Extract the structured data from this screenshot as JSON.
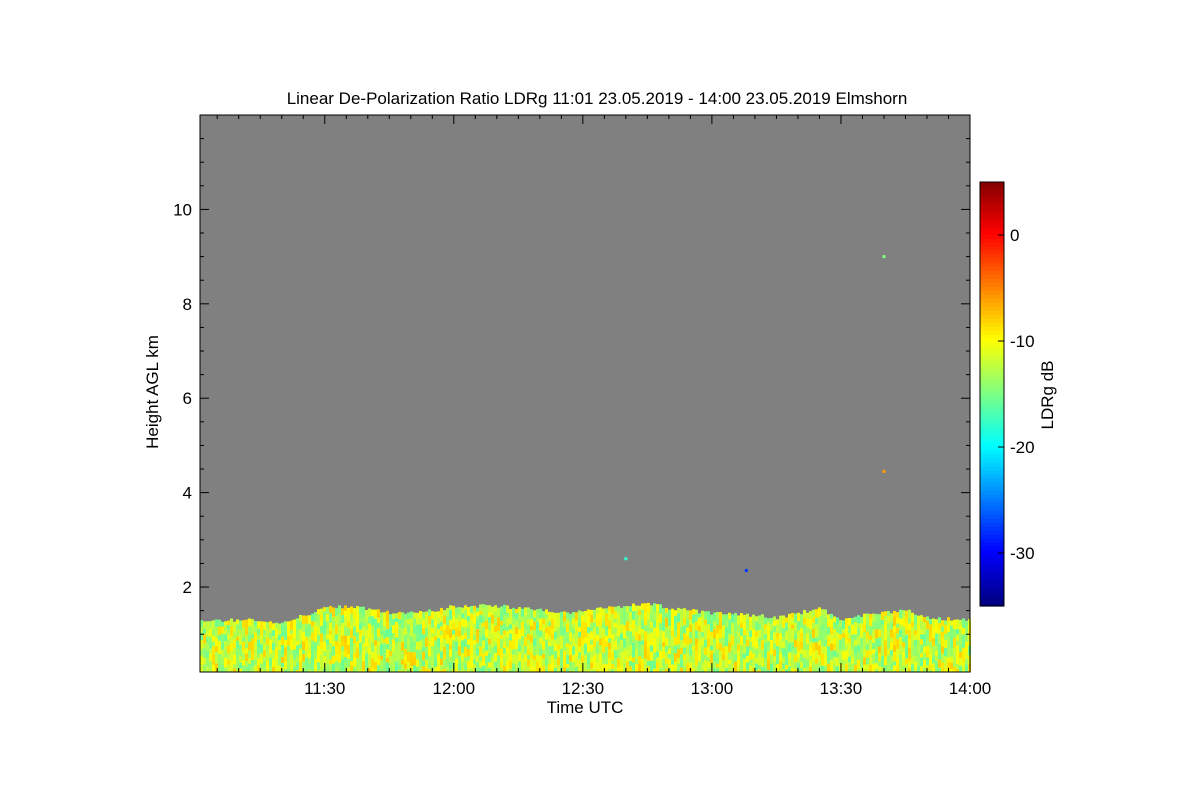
{
  "chart_data": {
    "type": "heatmap",
    "title": "Linear De-Polarization Ratio LDRg   11:01 23.05.2019 - 14:00 23.05.2019 Elmshorn",
    "xlabel": "Time UTC",
    "ylabel": "Height AGL km",
    "x_range": [
      "11:01",
      "14:00"
    ],
    "x_ticks": [
      "11:30",
      "12:00",
      "12:30",
      "13:00",
      "13:30",
      "14:00"
    ],
    "ylim": [
      0.2,
      12.0
    ],
    "y_ticks": [
      2,
      4,
      6,
      8,
      10
    ],
    "colorbar": {
      "label": "LDRg dB",
      "range": [
        -35,
        5
      ],
      "ticks": [
        0,
        -10,
        -20,
        -30
      ],
      "colormap": "jet"
    },
    "background_color": "#808080",
    "layers": [
      {
        "name": "boundary-layer",
        "base_km": 0.2,
        "top_km": [
          [
            "11:01",
            1.3
          ],
          [
            "11:15",
            1.3
          ],
          [
            "11:20",
            1.25
          ],
          [
            "11:25",
            1.4
          ],
          [
            "11:30",
            1.55
          ],
          [
            "11:35",
            1.6
          ],
          [
            "11:45",
            1.45
          ],
          [
            "11:55",
            1.5
          ],
          [
            "12:00",
            1.6
          ],
          [
            "12:10",
            1.6
          ],
          [
            "12:15",
            1.55
          ],
          [
            "12:25",
            1.45
          ],
          [
            "12:30",
            1.5
          ],
          [
            "12:40",
            1.6
          ],
          [
            "12:45",
            1.65
          ],
          [
            "12:50",
            1.55
          ],
          [
            "13:00",
            1.45
          ],
          [
            "13:10",
            1.4
          ],
          [
            "13:15",
            1.35
          ],
          [
            "13:25",
            1.55
          ],
          [
            "13:30",
            1.3
          ],
          [
            "13:35",
            1.4
          ],
          [
            "13:45",
            1.5
          ],
          [
            "13:50",
            1.35
          ],
          [
            "14:00",
            1.3
          ]
        ],
        "typical_ldr_db": [
          -16,
          -8
        ]
      }
    ],
    "sparse_echoes": [
      {
        "time": "13:40",
        "height_km": 9.0,
        "ldr_db": -15
      },
      {
        "time": "13:40",
        "height_km": 4.45,
        "ldr_db": -6
      },
      {
        "time": "12:40",
        "height_km": 2.6,
        "ldr_db": -18
      },
      {
        "time": "13:08",
        "height_km": 2.35,
        "ldr_db": -28
      }
    ]
  }
}
